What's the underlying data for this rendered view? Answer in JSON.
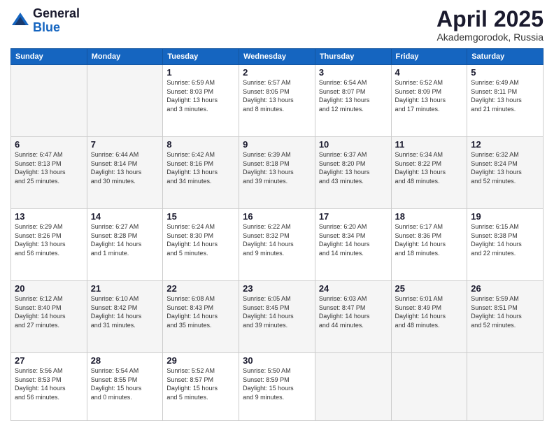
{
  "header": {
    "logo_general": "General",
    "logo_blue": "Blue",
    "title": "April 2025",
    "location": "Akademgorodok, Russia"
  },
  "days_of_week": [
    "Sunday",
    "Monday",
    "Tuesday",
    "Wednesday",
    "Thursday",
    "Friday",
    "Saturday"
  ],
  "weeks": [
    [
      {
        "day": "",
        "info": ""
      },
      {
        "day": "",
        "info": ""
      },
      {
        "day": "1",
        "info": "Sunrise: 6:59 AM\nSunset: 8:03 PM\nDaylight: 13 hours\nand 3 minutes."
      },
      {
        "day": "2",
        "info": "Sunrise: 6:57 AM\nSunset: 8:05 PM\nDaylight: 13 hours\nand 8 minutes."
      },
      {
        "day": "3",
        "info": "Sunrise: 6:54 AM\nSunset: 8:07 PM\nDaylight: 13 hours\nand 12 minutes."
      },
      {
        "day": "4",
        "info": "Sunrise: 6:52 AM\nSunset: 8:09 PM\nDaylight: 13 hours\nand 17 minutes."
      },
      {
        "day": "5",
        "info": "Sunrise: 6:49 AM\nSunset: 8:11 PM\nDaylight: 13 hours\nand 21 minutes."
      }
    ],
    [
      {
        "day": "6",
        "info": "Sunrise: 6:47 AM\nSunset: 8:13 PM\nDaylight: 13 hours\nand 25 minutes."
      },
      {
        "day": "7",
        "info": "Sunrise: 6:44 AM\nSunset: 8:14 PM\nDaylight: 13 hours\nand 30 minutes."
      },
      {
        "day": "8",
        "info": "Sunrise: 6:42 AM\nSunset: 8:16 PM\nDaylight: 13 hours\nand 34 minutes."
      },
      {
        "day": "9",
        "info": "Sunrise: 6:39 AM\nSunset: 8:18 PM\nDaylight: 13 hours\nand 39 minutes."
      },
      {
        "day": "10",
        "info": "Sunrise: 6:37 AM\nSunset: 8:20 PM\nDaylight: 13 hours\nand 43 minutes."
      },
      {
        "day": "11",
        "info": "Sunrise: 6:34 AM\nSunset: 8:22 PM\nDaylight: 13 hours\nand 48 minutes."
      },
      {
        "day": "12",
        "info": "Sunrise: 6:32 AM\nSunset: 8:24 PM\nDaylight: 13 hours\nand 52 minutes."
      }
    ],
    [
      {
        "day": "13",
        "info": "Sunrise: 6:29 AM\nSunset: 8:26 PM\nDaylight: 13 hours\nand 56 minutes."
      },
      {
        "day": "14",
        "info": "Sunrise: 6:27 AM\nSunset: 8:28 PM\nDaylight: 14 hours\nand 1 minute."
      },
      {
        "day": "15",
        "info": "Sunrise: 6:24 AM\nSunset: 8:30 PM\nDaylight: 14 hours\nand 5 minutes."
      },
      {
        "day": "16",
        "info": "Sunrise: 6:22 AM\nSunset: 8:32 PM\nDaylight: 14 hours\nand 9 minutes."
      },
      {
        "day": "17",
        "info": "Sunrise: 6:20 AM\nSunset: 8:34 PM\nDaylight: 14 hours\nand 14 minutes."
      },
      {
        "day": "18",
        "info": "Sunrise: 6:17 AM\nSunset: 8:36 PM\nDaylight: 14 hours\nand 18 minutes."
      },
      {
        "day": "19",
        "info": "Sunrise: 6:15 AM\nSunset: 8:38 PM\nDaylight: 14 hours\nand 22 minutes."
      }
    ],
    [
      {
        "day": "20",
        "info": "Sunrise: 6:12 AM\nSunset: 8:40 PM\nDaylight: 14 hours\nand 27 minutes."
      },
      {
        "day": "21",
        "info": "Sunrise: 6:10 AM\nSunset: 8:42 PM\nDaylight: 14 hours\nand 31 minutes."
      },
      {
        "day": "22",
        "info": "Sunrise: 6:08 AM\nSunset: 8:43 PM\nDaylight: 14 hours\nand 35 minutes."
      },
      {
        "day": "23",
        "info": "Sunrise: 6:05 AM\nSunset: 8:45 PM\nDaylight: 14 hours\nand 39 minutes."
      },
      {
        "day": "24",
        "info": "Sunrise: 6:03 AM\nSunset: 8:47 PM\nDaylight: 14 hours\nand 44 minutes."
      },
      {
        "day": "25",
        "info": "Sunrise: 6:01 AM\nSunset: 8:49 PM\nDaylight: 14 hours\nand 48 minutes."
      },
      {
        "day": "26",
        "info": "Sunrise: 5:59 AM\nSunset: 8:51 PM\nDaylight: 14 hours\nand 52 minutes."
      }
    ],
    [
      {
        "day": "27",
        "info": "Sunrise: 5:56 AM\nSunset: 8:53 PM\nDaylight: 14 hours\nand 56 minutes."
      },
      {
        "day": "28",
        "info": "Sunrise: 5:54 AM\nSunset: 8:55 PM\nDaylight: 15 hours\nand 0 minutes."
      },
      {
        "day": "29",
        "info": "Sunrise: 5:52 AM\nSunset: 8:57 PM\nDaylight: 15 hours\nand 5 minutes."
      },
      {
        "day": "30",
        "info": "Sunrise: 5:50 AM\nSunset: 8:59 PM\nDaylight: 15 hours\nand 9 minutes."
      },
      {
        "day": "",
        "info": ""
      },
      {
        "day": "",
        "info": ""
      },
      {
        "day": "",
        "info": ""
      }
    ]
  ]
}
